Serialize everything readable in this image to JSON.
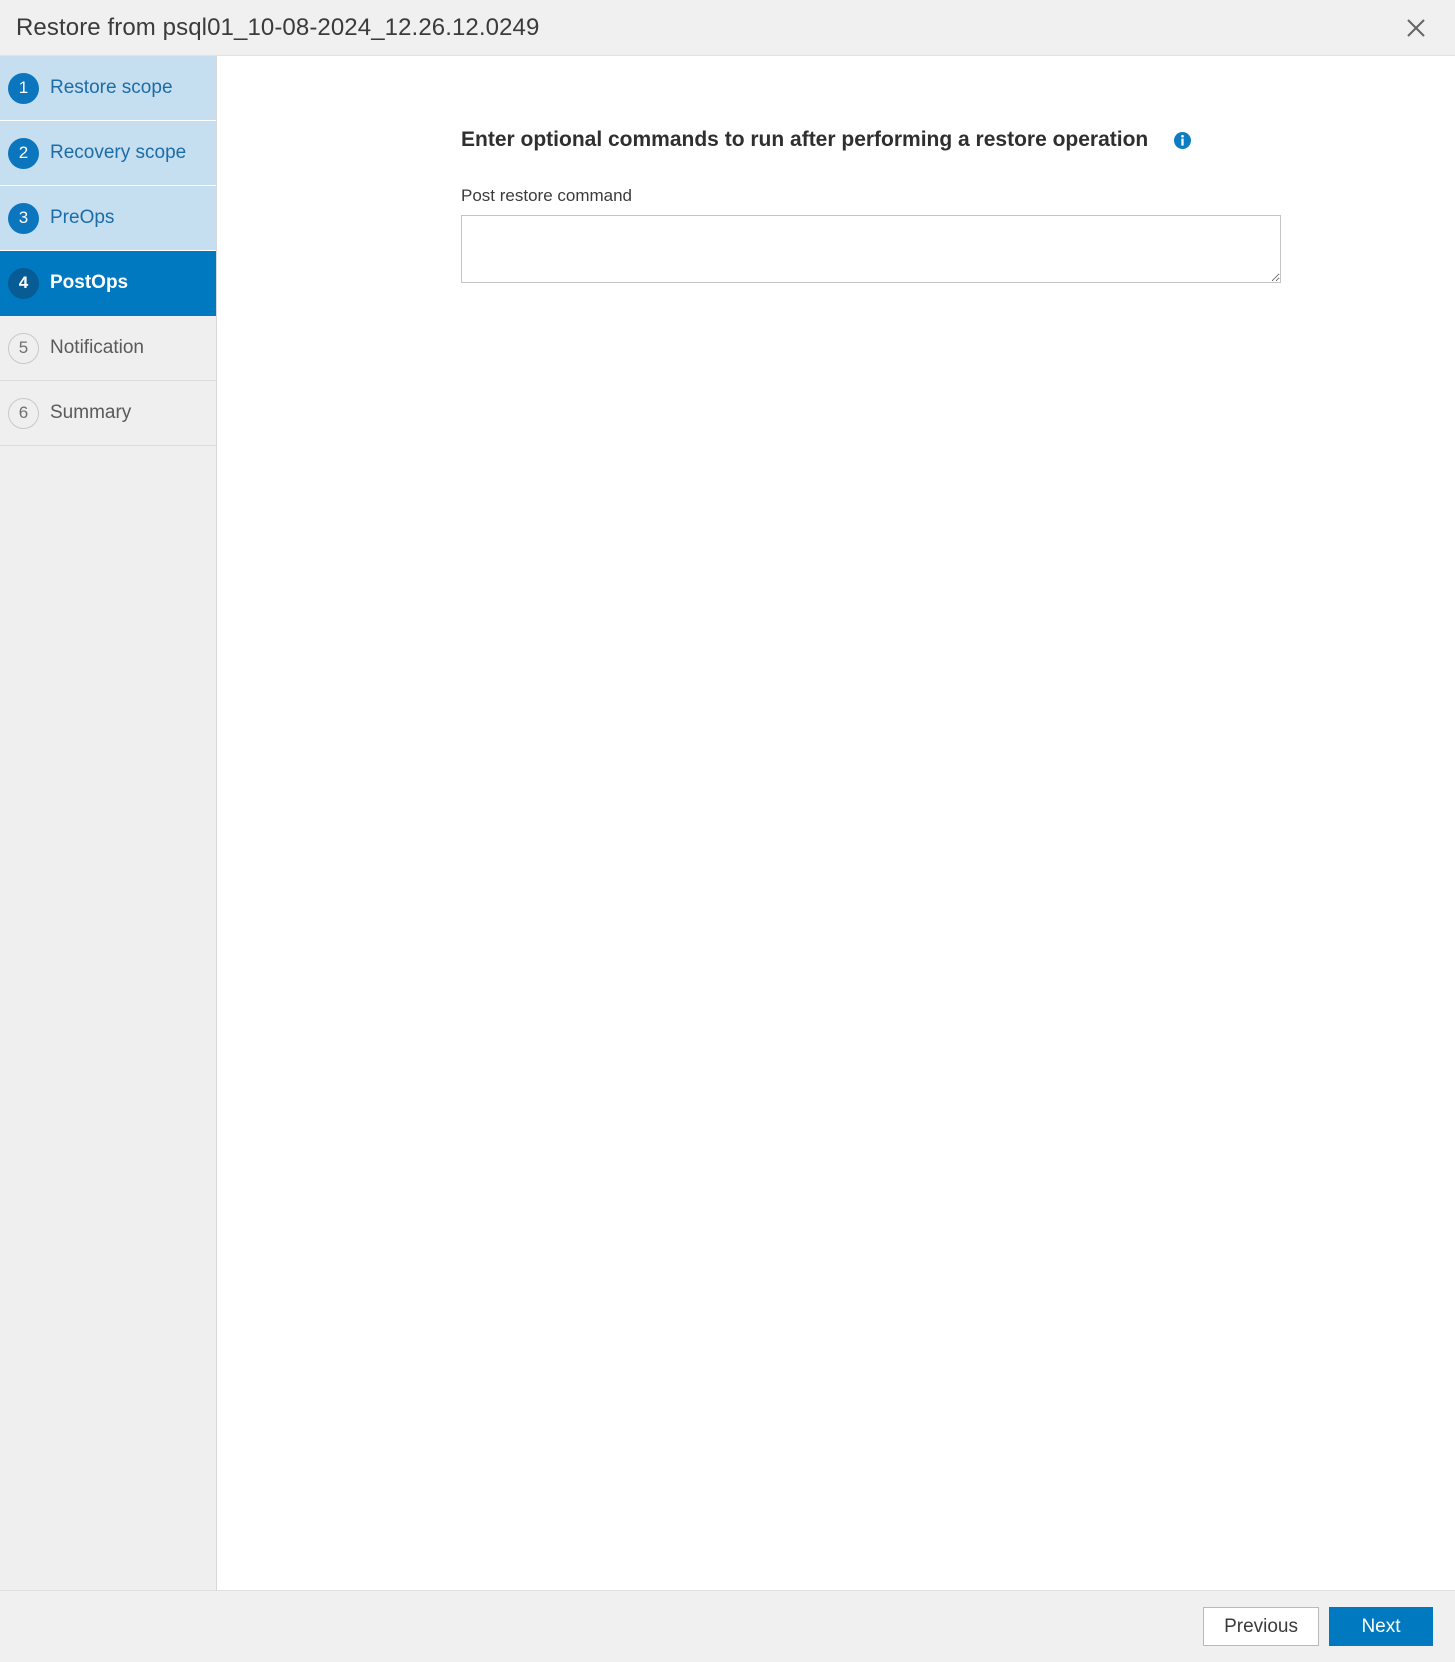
{
  "titlebar": {
    "title": "Restore from psql01_10-08-2024_12.26.12.0249",
    "close_icon": "close-icon",
    "close_label": "Close"
  },
  "sidebar": {
    "steps": [
      {
        "number": "1",
        "label": "Restore scope",
        "state": "done"
      },
      {
        "number": "2",
        "label": "Recovery scope",
        "state": "done"
      },
      {
        "number": "3",
        "label": "PreOps",
        "state": "done"
      },
      {
        "number": "4",
        "label": "PostOps",
        "state": "active"
      },
      {
        "number": "5",
        "label": "Notification",
        "state": "pending"
      },
      {
        "number": "6",
        "label": "Summary",
        "state": "pending"
      }
    ]
  },
  "content": {
    "heading": "Enter optional commands to run after performing a restore operation",
    "info_icon": "info-icon",
    "field_label": "Post restore command",
    "command_value": "",
    "command_placeholder": ""
  },
  "footer": {
    "previous_label": "Previous",
    "next_label": "Next"
  },
  "colors": {
    "accent": "#0079c1",
    "accent_dark": "#075c95",
    "step_done_bg": "#c5dff0",
    "chrome_bg": "#f0f0f0",
    "sidebar_bg": "#efefef"
  }
}
